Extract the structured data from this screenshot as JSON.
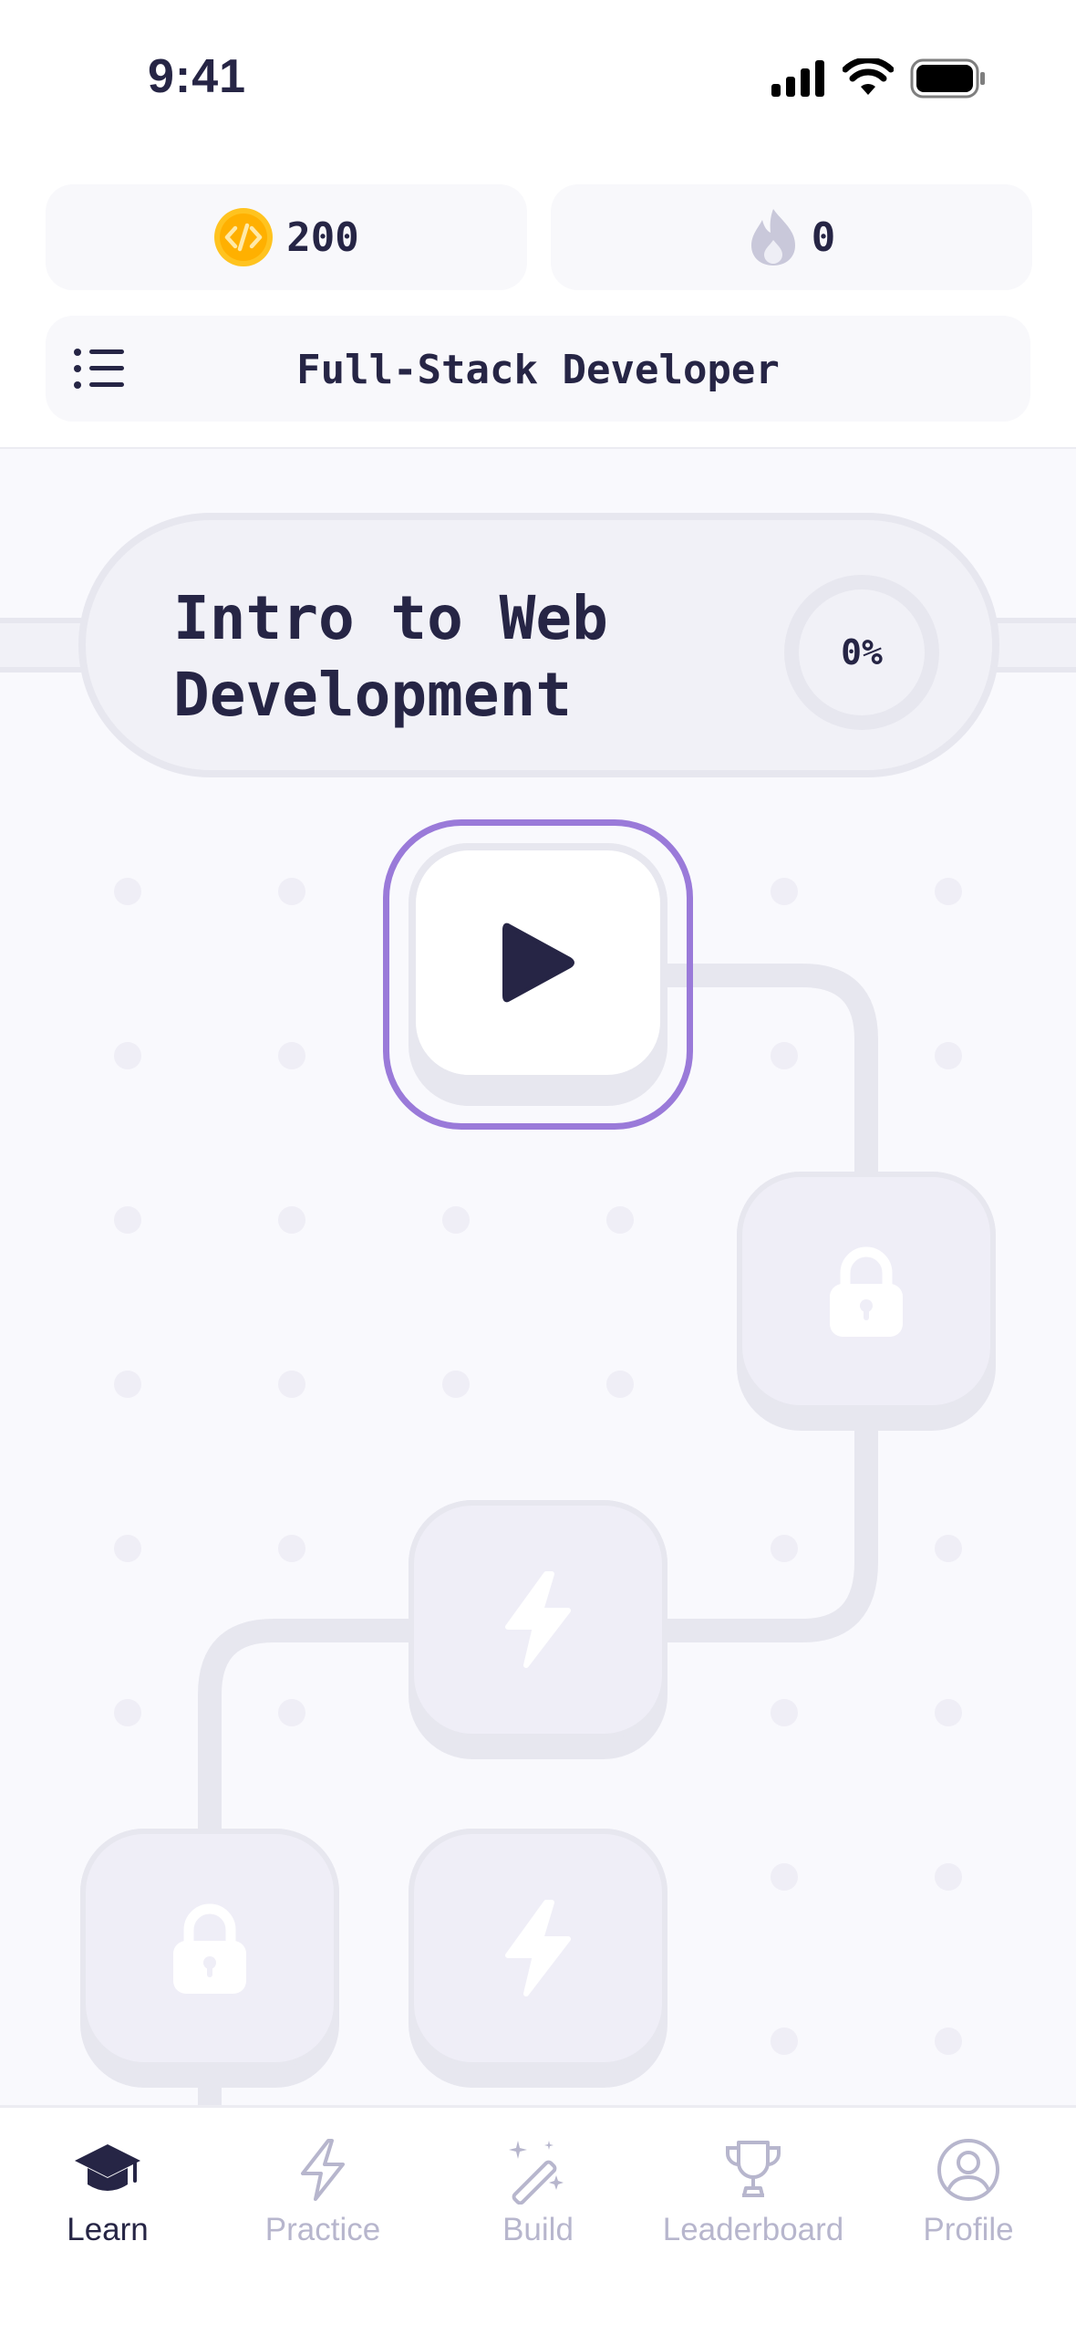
{
  "status_bar": {
    "time": "9:41"
  },
  "header": {
    "coins": "200",
    "streak": "0",
    "track_title": "Full-Stack Developer"
  },
  "unit": {
    "title_line1": "Intro to Web",
    "title_line2": "Development",
    "progress": "0%"
  },
  "tabs": [
    {
      "label": "Learn",
      "icon": "graduation-cap-icon",
      "selected": true
    },
    {
      "label": "Practice",
      "icon": "lightning-icon",
      "selected": false
    },
    {
      "label": "Build",
      "icon": "magic-wand-icon",
      "selected": false
    },
    {
      "label": "Leaderboard",
      "icon": "trophy-icon",
      "selected": false
    },
    {
      "label": "Profile",
      "icon": "user-circle-icon",
      "selected": false
    }
  ],
  "colors": {
    "accent": "#9a7ad9",
    "text": "#262545",
    "muted": "#b7b6cd",
    "coin": "#ffc31f",
    "map_bg": "#f9f9fd"
  }
}
